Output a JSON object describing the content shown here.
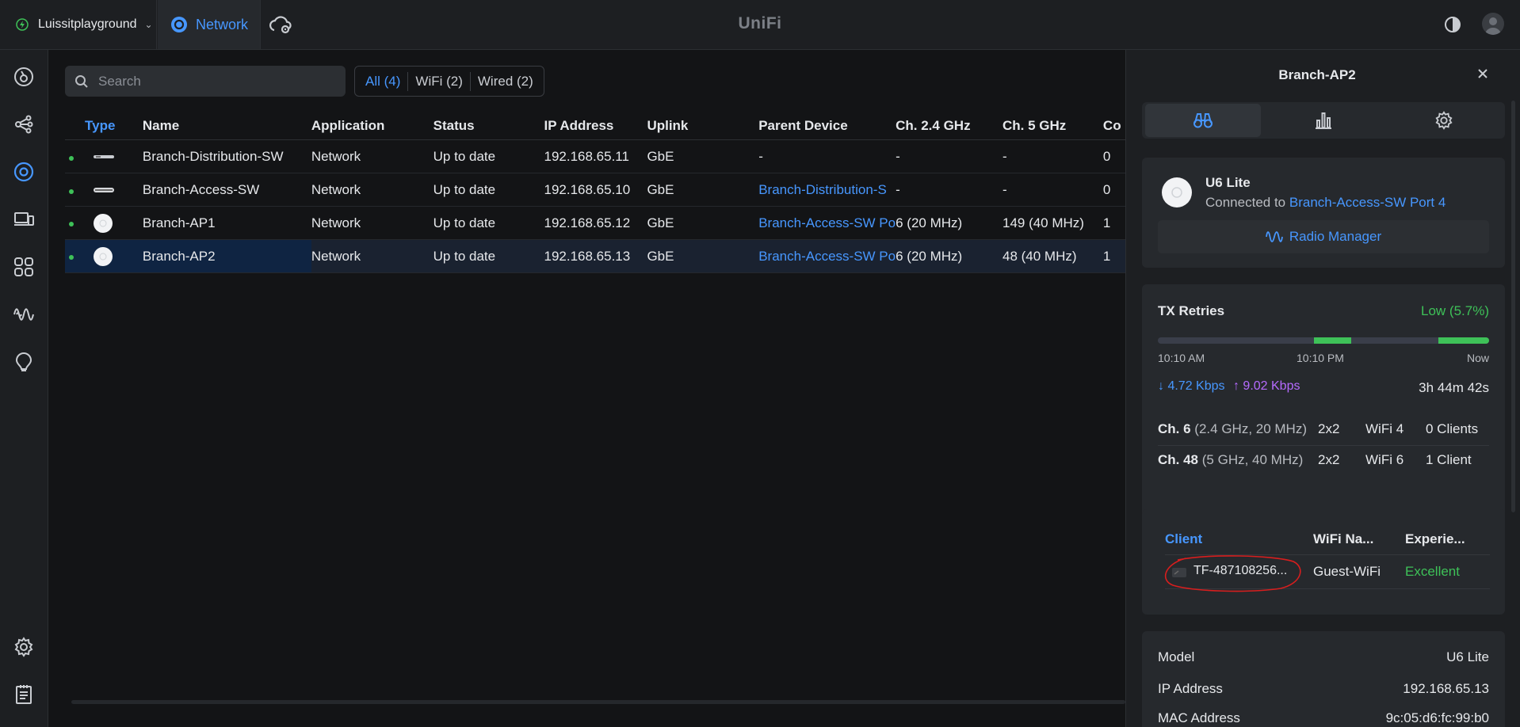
{
  "topbar": {
    "site_name": "Luissitplayground",
    "app_tab": "Network",
    "brand": "UniFi"
  },
  "toolbar": {
    "search_placeholder": "Search",
    "filters": [
      "All (4)",
      "WiFi (2)",
      "Wired (2)"
    ]
  },
  "table": {
    "columns": [
      "Type",
      "Name",
      "Application",
      "Status",
      "IP Address",
      "Uplink",
      "Parent Device",
      "Ch. 2.4 GHz",
      "Ch. 5 GHz",
      "Co"
    ],
    "rows": [
      {
        "name": "Branch-Distribution-SW",
        "application": "Network",
        "status": "Up to date",
        "ip": "192.168.65.11",
        "uplink": "GbE",
        "parent": "-",
        "ch24": "-",
        "ch5": "-",
        "clients": "0",
        "device_kind": "switch",
        "selected": false
      },
      {
        "name": "Branch-Access-SW",
        "application": "Network",
        "status": "Up to date",
        "ip": "192.168.65.10",
        "uplink": "GbE",
        "parent": "Branch-Distribution-S",
        "ch24": "-",
        "ch5": "-",
        "clients": "0",
        "device_kind": "switch",
        "selected": false
      },
      {
        "name": "Branch-AP1",
        "application": "Network",
        "status": "Up to date",
        "ip": "192.168.65.12",
        "uplink": "GbE",
        "parent": "Branch-Access-SW Po",
        "ch24": "6 (20 MHz)",
        "ch5": "149 (40 MHz)",
        "clients": "1",
        "device_kind": "ap",
        "selected": false
      },
      {
        "name": "Branch-AP2",
        "application": "Network",
        "status": "Up to date",
        "ip": "192.168.65.13",
        "uplink": "GbE",
        "parent": "Branch-Access-SW Po",
        "ch24": "6 (20 MHz)",
        "ch5": "48 (40 MHz)",
        "clients": "1",
        "device_kind": "ap",
        "selected": true
      }
    ]
  },
  "panel": {
    "title": "Branch-AP2",
    "device": {
      "model": "U6 Lite",
      "connected_prefix": "Connected to",
      "connected_link": "Branch-Access-SW Port 4",
      "radio_manager": "Radio Manager"
    },
    "tx": {
      "label": "TX Retries",
      "value": "Low (5.7%)",
      "time_start": "10:10 AM",
      "time_mid": "10:10 PM",
      "time_end": "Now",
      "down_rate": "4.72 Kbps",
      "up_rate": "9.02 Kbps",
      "uptime": "3h 44m 42s",
      "radios": [
        {
          "channel": "Ch. 6",
          "detail": "(2.4 GHz, 20 MHz)",
          "streams": "2x2",
          "wifi": "WiFi 4",
          "clients": "0 Clients"
        },
        {
          "channel": "Ch. 48",
          "detail": "(5 GHz, 40 MHz)",
          "streams": "2x2",
          "wifi": "WiFi 6",
          "clients": "1 Client"
        }
      ]
    },
    "clients_table": {
      "headers": [
        "Client",
        "WiFi Na...",
        "Experie..."
      ],
      "rows": [
        {
          "client": "TF-487108256...",
          "wifi": "Guest-WiFi",
          "experience": "Excellent"
        }
      ]
    },
    "details": [
      {
        "label": "Model",
        "value": "U6 Lite"
      },
      {
        "label": "IP Address",
        "value": "192.168.65.13"
      },
      {
        "label": "MAC Address",
        "value": "9c:05:d6:fc:99:b0"
      }
    ]
  },
  "colors": {
    "accent": "#4797ff",
    "good": "#3ec158",
    "upload": "#b66bff",
    "annotation": "#d81e1e"
  }
}
